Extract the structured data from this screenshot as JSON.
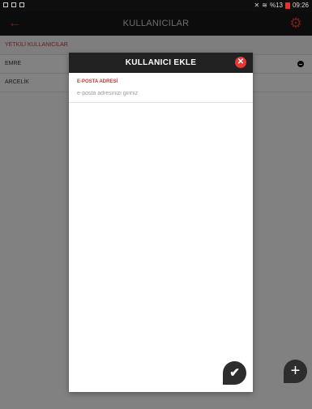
{
  "status_bar": {
    "icons": [
      "image-icon",
      "download-icon",
      "flag-icon",
      "mute-icon",
      "wifi-icon",
      "battery-icon"
    ],
    "battery": "%13",
    "time": "09:26"
  },
  "app_bar": {
    "title": "KULLANICILAR",
    "back_icon": "arrow-left-icon",
    "settings_icon": "gear-icon"
  },
  "users_list": {
    "section_title": "YETKİLİ KULLANICILAR",
    "items": [
      {
        "name": "EMRE",
        "has_remove": true
      },
      {
        "name": "ARCELİK",
        "has_remove": false
      }
    ]
  },
  "dialog": {
    "title": "KULLANICI EKLE",
    "close_icon": "close-icon",
    "email_label": "E-POSTA ADRESİ",
    "email_placeholder": "e-posta adresinizi giriniz",
    "email_value": "",
    "confirm_icon": "check-icon"
  },
  "fab": {
    "icon": "plus-icon"
  },
  "colors": {
    "accent": "#e43a34",
    "app_bar": "#171717",
    "dialog_header": "#212121",
    "fab": "#2d2d2d"
  }
}
